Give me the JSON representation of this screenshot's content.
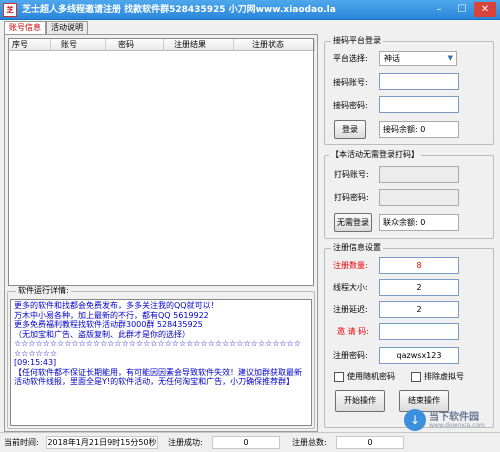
{
  "window": {
    "title": "芝士超人多线程邀请注册    找款软件群528435925    小刀网www.xiaodao.la",
    "icon_name": "app-logo-icon",
    "icon_text": "芝"
  },
  "tabs": [
    {
      "label": "账号信息",
      "active": true
    },
    {
      "label": "活动说明",
      "active": false
    }
  ],
  "table": {
    "columns": [
      "序号",
      "账号",
      "密码",
      "注册结果",
      "注册状态"
    ]
  },
  "log": {
    "title": "软件运行详情:",
    "text": "更多的软件和找都会免费发布，多多关注我的QQ就可以！\n万木中小易各种，加上最新的不行，都有QQ 5619922\n更多免费福利教程找软件活动群3000群 528435925\n（无加宝和广告、盗版复制、此群才是你的选择）\n☆☆☆☆☆☆☆☆☆☆☆☆☆☆☆☆☆☆☆☆☆☆☆☆☆☆☆☆☆☆☆☆☆☆☆☆☆☆☆☆☆☆☆☆☆☆\n[09:15:43]\n【任何软件都不保证长期能用，有可能因因素会导致软件失效！建议加群获取最新活动软件线报，里面全是Y!的软件活动，无任何淘宝和广告，小刀确保推荐群】"
  },
  "login_group": {
    "legend": "接码平台登录",
    "platform_label": "平台选择:",
    "platform_value": "神话",
    "account_label": "接码账号:",
    "account_value": "",
    "password_label": "接码密码:",
    "password_value": "",
    "login_button": "登录",
    "balance_text": "接码余额: 0"
  },
  "manual_group": {
    "legend": "【本活动无需登录打码】",
    "account_label": "打码账号:",
    "password_label": "打码密码:",
    "no_login_button": "无需登录",
    "balance_text": "联众余额: 0"
  },
  "settings_group": {
    "legend": "注册信息设置",
    "count_label": "注册数量:",
    "count_value": "8",
    "threads_label": "线程大小:",
    "threads_value": "2",
    "delay_label": "注册延迟:",
    "delay_value": "2",
    "invite_label": "邀 请 码:",
    "invite_value": "",
    "regpwd_label": "注册密码:",
    "regpwd_value": "qazwsx123",
    "random_pwd_label": "使用随机密码",
    "exclude_virtual_label": "排除虚拟号",
    "start_button": "开始操作",
    "stop_button": "结束操作"
  },
  "status_bar": {
    "time_label": "当前时间:",
    "time_value": "2018年1月21日9时15分50秒",
    "success_label": "注册成功:",
    "success_value": "0",
    "total_label": "注册总数:",
    "total_value": "0"
  },
  "watermark": {
    "line1": "当下软件园",
    "line2": "www.downxia.com"
  },
  "colors": {
    "titlebar": "#2a86dc",
    "highlight_red": "#e00000",
    "log_text": "#0000cc"
  }
}
